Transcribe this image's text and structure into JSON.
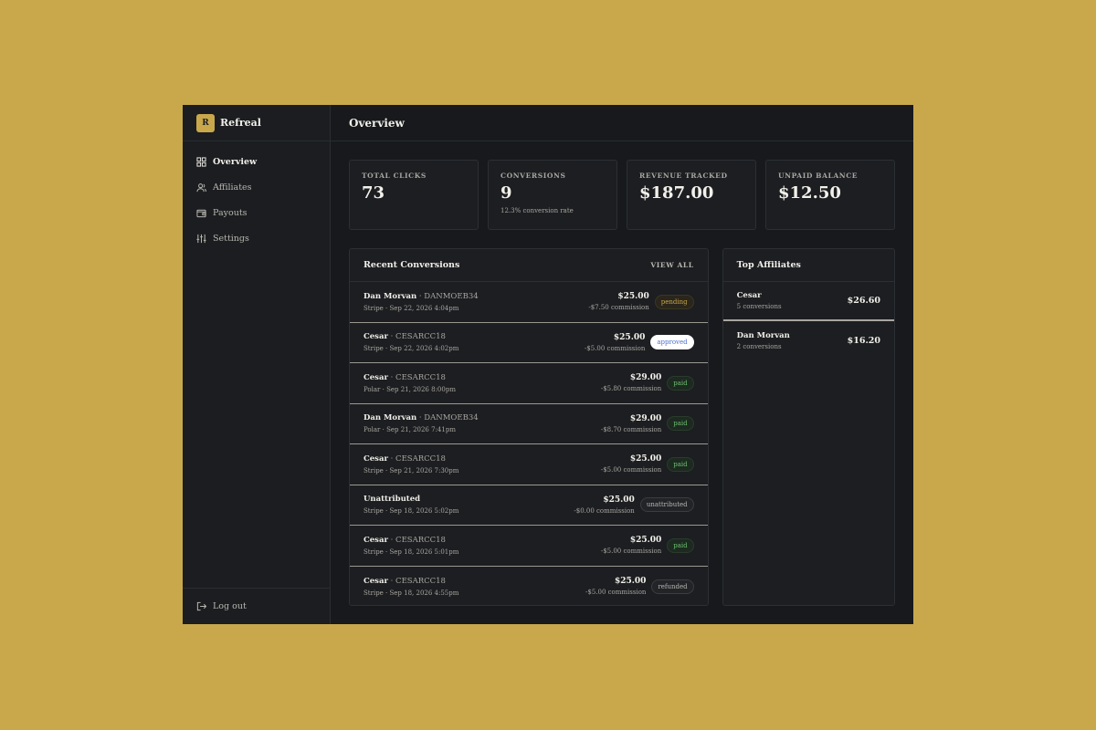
{
  "brand": {
    "logo_letter": "R",
    "name": "Refreal"
  },
  "sidebar": {
    "items": [
      {
        "label": "Overview",
        "icon": "grid-icon"
      },
      {
        "label": "Affiliates",
        "icon": "users-icon"
      },
      {
        "label": "Payouts",
        "icon": "wallet-icon"
      },
      {
        "label": "Settings",
        "icon": "sliders-icon"
      }
    ],
    "logout_label": "Log out"
  },
  "header": {
    "title": "Overview"
  },
  "stats": [
    {
      "label": "TOTAL CLICKS",
      "value": "73",
      "sub": ""
    },
    {
      "label": "CONVERSIONS",
      "value": "9",
      "sub": "12.3% conversion rate"
    },
    {
      "label": "REVENUE TRACKED",
      "value": "$187.00",
      "sub": ""
    },
    {
      "label": "UNPAID BALANCE",
      "value": "$12.50",
      "sub": ""
    }
  ],
  "recent_conversions": {
    "title": "Recent Conversions",
    "view_all_label": "VIEW ALL",
    "rows": [
      {
        "name": "Dan Morvan",
        "code": "DANMOEB34",
        "meta": "Stripe · Sep 22, 2026 4:04pm",
        "amount": "$25.00",
        "commission": "-$7.50 commission",
        "status": "pending"
      },
      {
        "name": "Cesar",
        "code": "CESARCC18",
        "meta": "Stripe · Sep 22, 2026 4:02pm",
        "amount": "$25.00",
        "commission": "-$5.00 commission",
        "status": "approved"
      },
      {
        "name": "Cesar",
        "code": "CESARCC18",
        "meta": "Polar · Sep 21, 2026 8:00pm",
        "amount": "$29.00",
        "commission": "-$5.80 commission",
        "status": "paid"
      },
      {
        "name": "Dan Morvan",
        "code": "DANMOEB34",
        "meta": "Polar · Sep 21, 2026 7:41pm",
        "amount": "$29.00",
        "commission": "-$8.70 commission",
        "status": "paid"
      },
      {
        "name": "Cesar",
        "code": "CESARCC18",
        "meta": "Stripe · Sep 21, 2026 7:30pm",
        "amount": "$25.00",
        "commission": "-$5.00 commission",
        "status": "paid"
      },
      {
        "name": "Unattributed",
        "code": "",
        "meta": "Stripe · Sep 18, 2026 5:02pm",
        "amount": "$25.00",
        "commission": "-$0.00 commission",
        "status": "unattributed"
      },
      {
        "name": "Cesar",
        "code": "CESARCC18",
        "meta": "Stripe · Sep 18, 2026 5:01pm",
        "amount": "$25.00",
        "commission": "-$5.00 commission",
        "status": "paid"
      },
      {
        "name": "Cesar",
        "code": "CESARCC18",
        "meta": "Stripe · Sep 18, 2026 4:55pm",
        "amount": "$25.00",
        "commission": "-$5.00 commission",
        "status": "refunded"
      }
    ]
  },
  "top_affiliates": {
    "title": "Top Affiliates",
    "rows": [
      {
        "name": "Cesar",
        "conversions": "5 conversions",
        "amount": "$26.60"
      },
      {
        "name": "Dan Morvan",
        "conversions": "2 conversions",
        "amount": "$16.20"
      }
    ]
  },
  "colors": {
    "accent": "#c9a84c",
    "background": "#17191c",
    "paid": "#6fbf73",
    "approved": "#4a6fd0"
  }
}
